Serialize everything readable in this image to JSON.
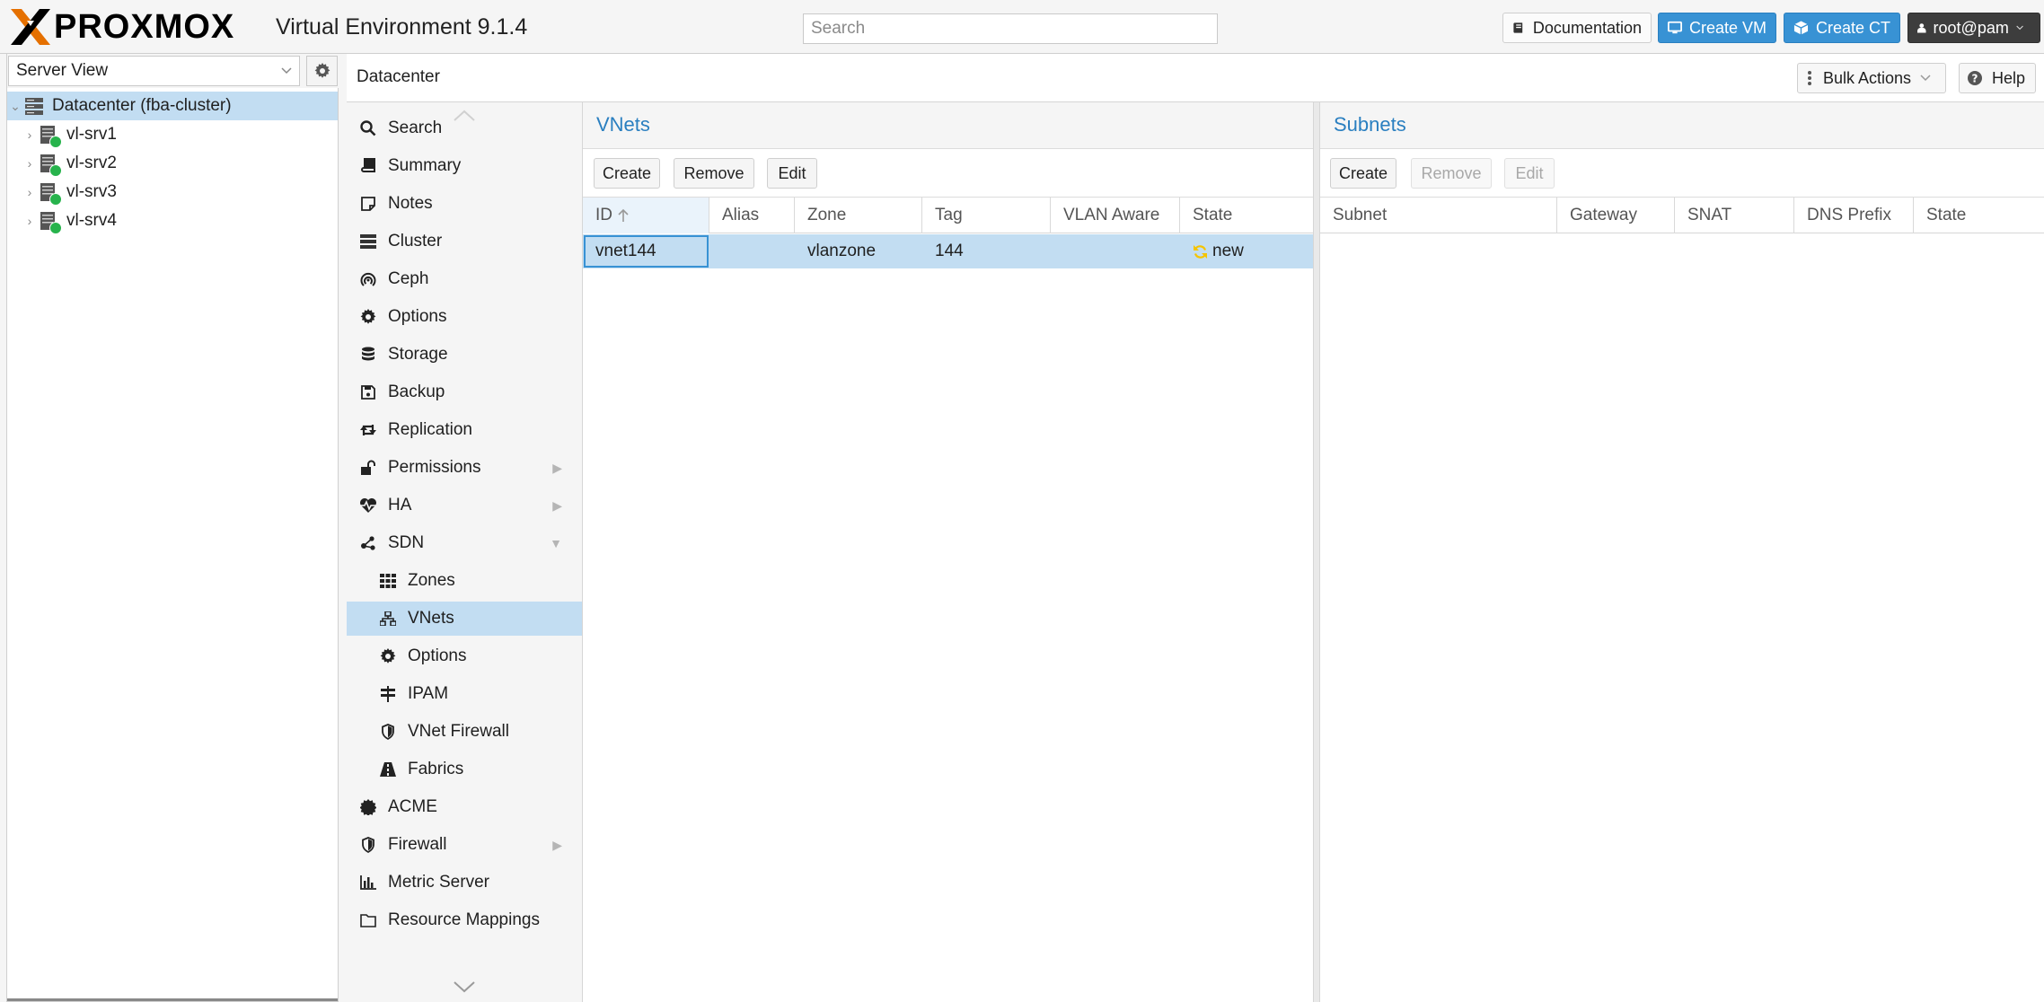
{
  "header": {
    "logo_text": "PROXMOX",
    "product_title": "Virtual Environment 9.1.4",
    "search_placeholder": "Search",
    "documentation_label": "Documentation",
    "create_vm_label": "Create VM",
    "create_ct_label": "Create CT",
    "user_label": "root@pam"
  },
  "left": {
    "view_selector": "Server View",
    "tree": [
      {
        "label": "Datacenter (fba-cluster)",
        "type": "datacenter",
        "selected": true
      },
      {
        "label": "vl-srv1",
        "type": "node",
        "status": "online"
      },
      {
        "label": "vl-srv2",
        "type": "node",
        "status": "online"
      },
      {
        "label": "vl-srv3",
        "type": "node",
        "status": "online"
      },
      {
        "label": "vl-srv4",
        "type": "node",
        "status": "online"
      }
    ]
  },
  "content_header": {
    "breadcrumb": "Datacenter",
    "bulk_actions_label": "Bulk Actions",
    "help_label": "Help"
  },
  "nav": {
    "items": [
      {
        "label": "Search",
        "icon": "search-icon"
      },
      {
        "label": "Summary",
        "icon": "book-icon"
      },
      {
        "label": "Notes",
        "icon": "note-icon"
      },
      {
        "label": "Cluster",
        "icon": "server-icon"
      },
      {
        "label": "Ceph",
        "icon": "ceph-icon"
      },
      {
        "label": "Options",
        "icon": "gear-icon"
      },
      {
        "label": "Storage",
        "icon": "database-icon"
      },
      {
        "label": "Backup",
        "icon": "floppy-icon"
      },
      {
        "label": "Replication",
        "icon": "retweet-icon"
      },
      {
        "label": "Permissions",
        "icon": "unlock-icon",
        "expandable": true
      },
      {
        "label": "HA",
        "icon": "heartbeat-icon",
        "expandable": true
      },
      {
        "label": "SDN",
        "icon": "sdn-icon",
        "expanded": true
      },
      {
        "label": "Zones",
        "icon": "grid-icon",
        "sub": true
      },
      {
        "label": "VNets",
        "icon": "network-icon",
        "sub": true,
        "active": true
      },
      {
        "label": "Options",
        "icon": "gear-icon",
        "sub": true
      },
      {
        "label": "IPAM",
        "icon": "ipam-icon",
        "sub": true
      },
      {
        "label": "VNet Firewall",
        "icon": "shield-icon",
        "sub": true
      },
      {
        "label": "Fabrics",
        "icon": "road-icon",
        "sub": true
      },
      {
        "label": "ACME",
        "icon": "certificate-icon"
      },
      {
        "label": "Firewall",
        "icon": "shield-icon",
        "expandable": true
      },
      {
        "label": "Metric Server",
        "icon": "bar-chart-icon"
      },
      {
        "label": "Resource Mappings",
        "icon": "folder-icon"
      }
    ]
  },
  "vnets": {
    "title": "VNets",
    "buttons": {
      "create": "Create",
      "remove": "Remove",
      "edit": "Edit"
    },
    "columns": [
      "ID",
      "Alias",
      "Zone",
      "Tag",
      "VLAN Aware",
      "State"
    ],
    "rows": [
      {
        "id": "vnet144",
        "alias": "",
        "zone": "vlanzone",
        "tag": "144",
        "vlan_aware": "",
        "state": "new"
      }
    ]
  },
  "subnets": {
    "title": "Subnets",
    "buttons": {
      "create": "Create",
      "remove": "Remove",
      "edit": "Edit"
    },
    "columns": [
      "Subnet",
      "Gateway",
      "SNAT",
      "DNS Prefix",
      "State"
    ],
    "rows": []
  },
  "colors": {
    "accent": "#3892d4",
    "logo_orange": "#e57000",
    "selection": "#c2ddf2",
    "status_ok": "#27b34c",
    "state_new": "#f5c400"
  }
}
